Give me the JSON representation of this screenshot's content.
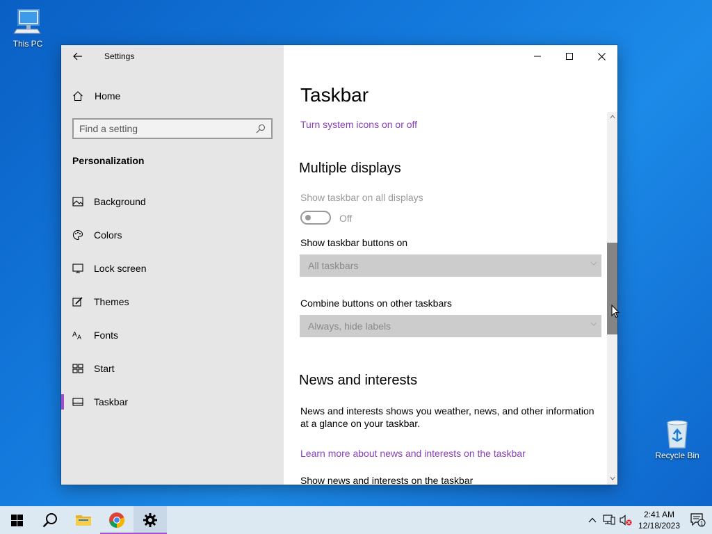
{
  "desktop": {
    "this_pc_label": "This PC",
    "recycle_bin_label": "Recycle Bin"
  },
  "window": {
    "app_title": "Settings",
    "controls": [
      "minimize-icon",
      "maximize-icon",
      "close-icon"
    ]
  },
  "sidebar": {
    "home_label": "Home",
    "search_placeholder": "Find a setting",
    "section_title": "Personalization",
    "items": [
      {
        "label": "Background",
        "icon": "picture-icon"
      },
      {
        "label": "Colors",
        "icon": "palette-icon"
      },
      {
        "label": "Lock screen",
        "icon": "monitor-icon"
      },
      {
        "label": "Themes",
        "icon": "brush-icon"
      },
      {
        "label": "Fonts",
        "icon": "fonts-icon"
      },
      {
        "label": "Start",
        "icon": "start-grid-icon"
      },
      {
        "label": "Taskbar",
        "icon": "taskbar-icon",
        "selected": true
      }
    ]
  },
  "main": {
    "page_title": "Taskbar",
    "system_icons_link": "Turn system icons on or off",
    "multiple_displays": {
      "heading": "Multiple displays",
      "show_all_label": "Show taskbar on all displays",
      "toggle_state": "Off",
      "buttons_on_label": "Show taskbar buttons on",
      "buttons_on_value": "All taskbars",
      "combine_label": "Combine buttons on other taskbars",
      "combine_value": "Always, hide labels"
    },
    "news": {
      "heading": "News and interests",
      "description": "News and interests shows you weather, news, and other information at a glance on your taskbar.",
      "learn_more_link": "Learn more about news and interests on the taskbar",
      "show_label": "Show news and interests on the taskbar"
    }
  },
  "taskbar": {
    "pinned": [
      "start-icon",
      "search-icon",
      "file-explorer-icon",
      "chrome-icon",
      "settings-icon"
    ],
    "time": "2:41 AM",
    "date": "12/18/2023",
    "notification_count": "1"
  },
  "colors": {
    "accent": "#9b4dca",
    "link": "#8a3fb8",
    "sidebar_bg": "#e6e6e6",
    "taskbar_bg": "#dde9f2"
  }
}
